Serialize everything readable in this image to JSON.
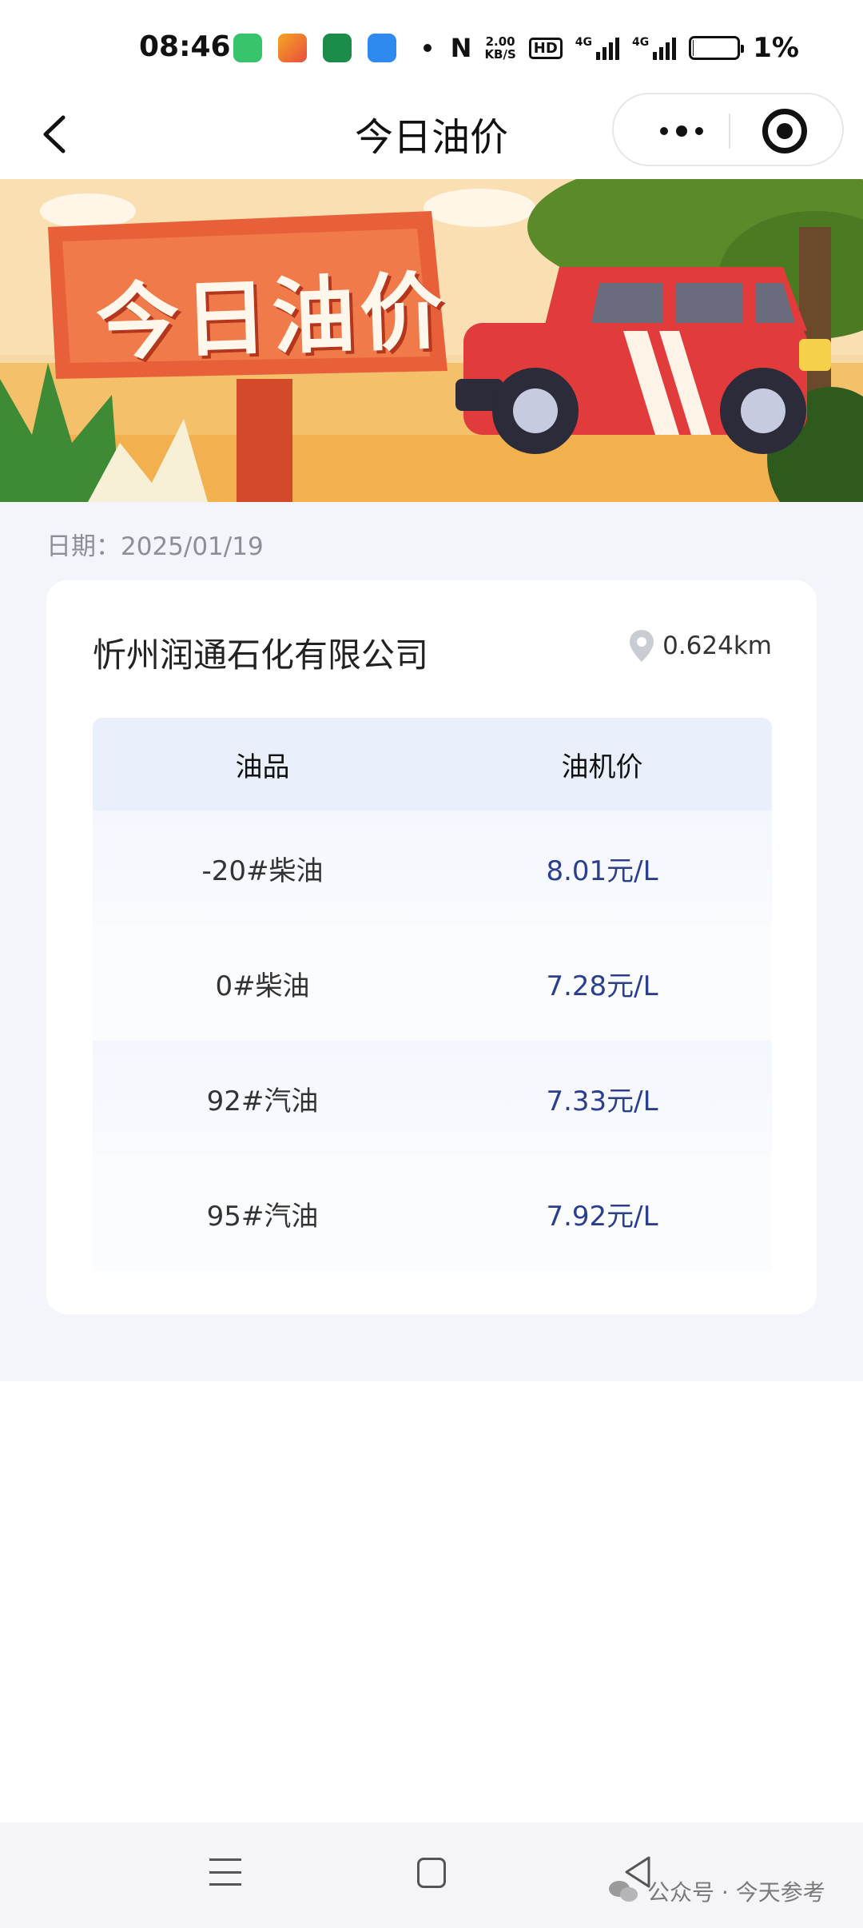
{
  "status_bar": {
    "time": "08:46",
    "speed_value": "2.00",
    "speed_unit": "KB/S",
    "hd_label": "HD",
    "net1": "4G",
    "net2": "4G",
    "battery_percent": "1%",
    "battery_level": 0.01
  },
  "nav": {
    "title": "今日油价"
  },
  "banner": {
    "sign_text": "今日油价"
  },
  "date": {
    "label": "日期：2025/01/19"
  },
  "station": {
    "name": "忻州润通石化有限公司",
    "distance": "0.624km"
  },
  "table": {
    "headers": [
      "油品",
      "油机价"
    ],
    "rows": [
      {
        "name": "-20#柴油",
        "price": "8.01元/L"
      },
      {
        "name": "0#柴油",
        "price": "7.28元/L"
      },
      {
        "name": "92#汽油",
        "price": "7.33元/L"
      },
      {
        "name": "95#汽油",
        "price": "7.92元/L"
      }
    ]
  },
  "watermark": {
    "text": "公众号 · 今天参考"
  },
  "colors": {
    "price": "#2a3f8e",
    "page_bg": "#f3f5fa",
    "table_header_bg": "#eaf0fb",
    "banner_sign": "#e8603a"
  }
}
